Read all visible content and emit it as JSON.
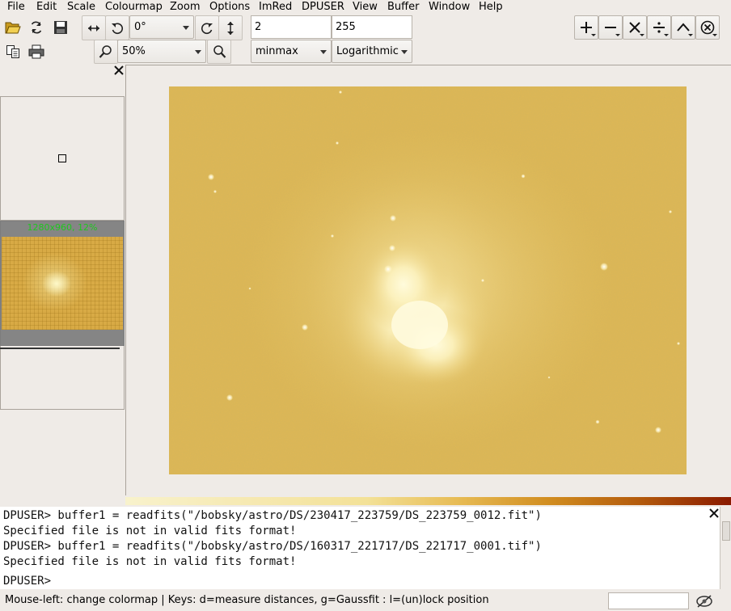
{
  "menu": [
    "File",
    "Edit",
    "Scale",
    "Colourmap",
    "Zoom",
    "Options",
    "ImRed",
    "DPUSER",
    "View",
    "Buffer",
    "Window",
    "Help"
  ],
  "toolbar": {
    "rotation": "0°",
    "zoom": "50%",
    "scale_min": "2",
    "scale_max": "255",
    "scale_method": "minmax",
    "scale_type": "Logarithmic"
  },
  "thumbnail": {
    "label": "1280x960, 12%"
  },
  "console": {
    "lines": [
      "DPUSER> buffer1 = readfits(\"/bobsky/astro/DS/230417_223759/DS_223759_0012.fit\")",
      "Specified file is not in valid fits format!",
      "DPUSER> buffer1 = readfits(\"/bobsky/astro/DS/160317_221717/DS_221717_0001.tif\")",
      "Specified file is not in valid fits format!"
    ],
    "prompt": "DPUSER>"
  },
  "status": {
    "text": "Mouse-left: change colormap | Keys: d=measure distances, g=Gaussfit : l=(un)lock position"
  },
  "colors": {
    "image_background": "#dfb855",
    "nebula": "#fff7c8",
    "colorbar_start": "#f8f2cc",
    "colorbar_end": "#8a1a00"
  },
  "icons": {
    "open": "folder-open-icon",
    "reload": "reload-icon",
    "save": "save-icon",
    "copy": "copy-icon",
    "print": "print-icon",
    "flip_h": "flip-horizontal-icon",
    "rotate_ccw": "rotate-ccw-icon",
    "rotate_cw": "rotate-cw-icon",
    "flip_v": "flip-vertical-icon",
    "zoom_out": "zoom-out-icon",
    "zoom_in": "zoom-in-icon",
    "add": "plus-icon",
    "subtract": "minus-icon",
    "multiply": "multiply-icon",
    "divide": "divide-icon",
    "power": "power-icon",
    "cancel": "cancel-icon"
  }
}
